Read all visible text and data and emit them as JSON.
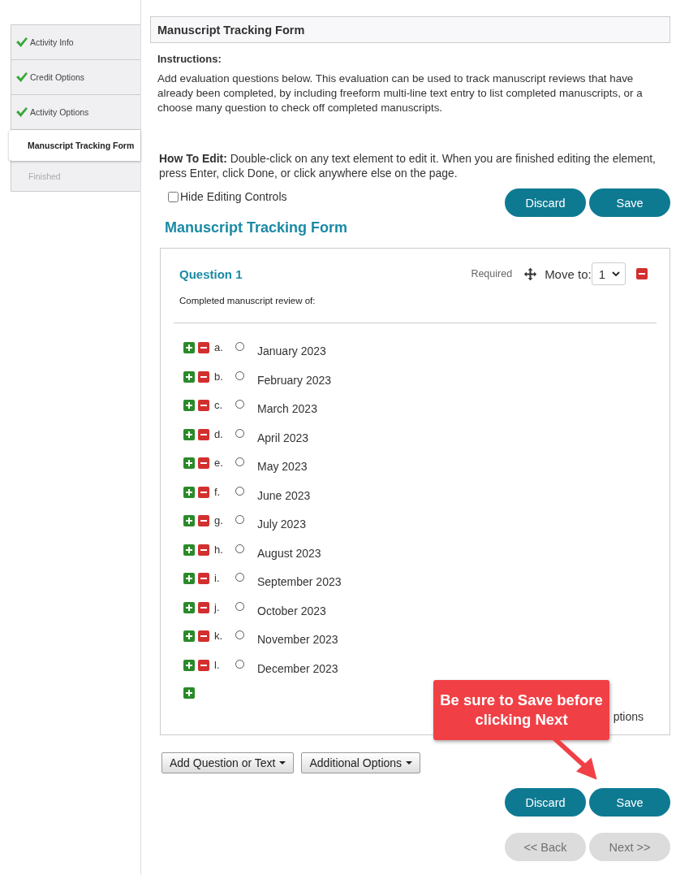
{
  "sidebar": {
    "items": [
      {
        "label": "Activity Info",
        "completed": true,
        "selected": false,
        "disabled": false
      },
      {
        "label": "Credit Options",
        "completed": true,
        "selected": false,
        "disabled": false
      },
      {
        "label": "Activity Options",
        "completed": true,
        "selected": false,
        "disabled": false
      },
      {
        "label": "Manuscript Tracking Form",
        "completed": false,
        "selected": true,
        "disabled": false
      },
      {
        "label": "Finished",
        "completed": false,
        "selected": false,
        "disabled": true
      }
    ]
  },
  "header": {
    "title": "Manuscript Tracking Form"
  },
  "instructions": {
    "heading": "Instructions:",
    "text": "Add evaluation questions below. This evaluation can be used to track manuscript reviews that have already been completed, by including freeform multi-line text entry to list completed manuscripts, or a choose many question to check off completed manuscripts."
  },
  "how_to_edit": "**How To Edit:** Double-click on any text element to edit it. When you are finished editing the element, press Enter, click Done, or click anywhere else on the page.",
  "hide_editing_controls": {
    "label": "Hide Editing Controls",
    "checked": false
  },
  "top_buttons": [
    "Discard",
    "Save"
  ],
  "form_title": "Manuscript Tracking Form",
  "question": {
    "title": "Question 1",
    "required_label": "Required",
    "move_to_label": "Move to:",
    "move_to_value": "1",
    "prompt": "Completed manuscript review of:",
    "options": [
      {
        "letter": "a.",
        "label": "January 2023",
        "selected": false
      },
      {
        "letter": "b.",
        "label": "February 2023",
        "selected": false
      },
      {
        "letter": "c.",
        "label": "March 2023",
        "selected": false
      },
      {
        "letter": "d.",
        "label": "April 2023",
        "selected": false
      },
      {
        "letter": "e.",
        "label": "May 2023",
        "selected": false
      },
      {
        "letter": "f.",
        "label": "June 2023",
        "selected": false
      },
      {
        "letter": "g.",
        "label": "July 2023",
        "selected": false
      },
      {
        "letter": "h.",
        "label": "August 2023",
        "selected": false
      },
      {
        "letter": "i.",
        "label": "September 2023",
        "selected": false
      },
      {
        "letter": "j.",
        "label": "October 2023",
        "selected": false
      },
      {
        "letter": "k.",
        "label": "November 2023",
        "selected": false
      },
      {
        "letter": "l.",
        "label": "December 2023",
        "selected": false
      }
    ],
    "footer_text": "ptions"
  },
  "menu_buttons": [
    "Add Question or Text",
    "Additional Options"
  ],
  "bottom_buttons": [
    "Discard",
    "Save"
  ],
  "nav_buttons": [
    {
      "label": "<< Back",
      "disabled": true
    },
    {
      "label": "Next >>",
      "disabled": true
    }
  ],
  "callout": {
    "text": "Be sure to Save before clicking Next"
  }
}
